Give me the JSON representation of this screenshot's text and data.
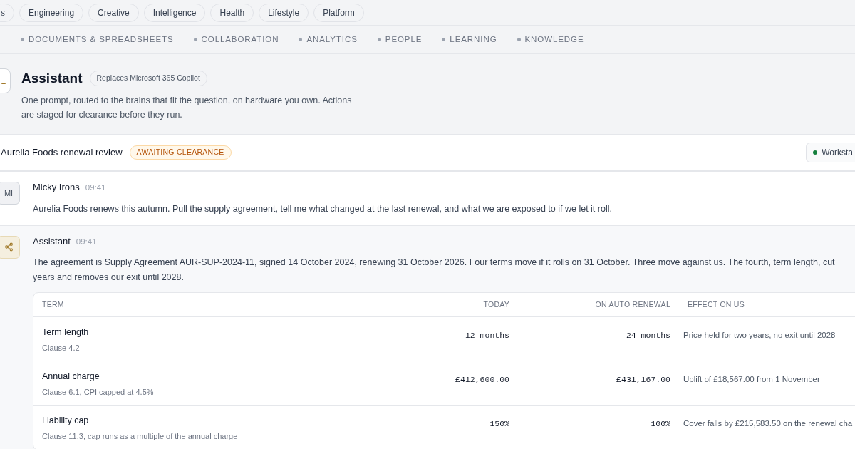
{
  "category_pills": [
    {
      "label": "s",
      "selected": false
    },
    {
      "label": "Engineering",
      "selected": false
    },
    {
      "label": "Creative",
      "selected": false
    },
    {
      "label": "Intelligence",
      "selected": false
    },
    {
      "label": "Health",
      "selected": false
    },
    {
      "label": "Lifestyle",
      "selected": false
    },
    {
      "label": "Platform",
      "selected": false
    }
  ],
  "section_nav": [
    {
      "label": "DOCUMENTS & SPREADSHEETS"
    },
    {
      "label": "COLLABORATION"
    },
    {
      "label": "ANALYTICS"
    },
    {
      "label": "PEOPLE"
    },
    {
      "label": "LEARNING"
    },
    {
      "label": "KNOWLEDGE"
    }
  ],
  "app_header": {
    "title": "Assistant",
    "badge": "Replaces Microsoft 365 Copilot",
    "description_lines": [
      "One prompt, routed to the brains that fit the question, on hardware you own. Actions",
      "are staged for clearance before they run."
    ]
  },
  "thread": {
    "title": "Aurelia Foods renewal review",
    "status": "AWAITING CLEARANCE",
    "host": {
      "label": "Worksta",
      "color": "#15803d"
    }
  },
  "messages": [
    {
      "kind": "user",
      "avatar": "MI",
      "author": "Micky Irons",
      "time": "09:41",
      "lines": [
        "Aurelia Foods renews this autumn. Pull the supply agreement, tell me what changed at the last renewal, and what we are exposed to if we let it roll."
      ]
    },
    {
      "kind": "assistant",
      "author": "Assistant",
      "time": "09:41",
      "lines": [
        "The agreement is Supply Agreement AUR-SUP-2024-11, signed 14 October 2024, renewing 31 October 2026. Four terms move if it rolls on 31 October. Three move against us. The fourth, term length, cut",
        "years and removes our exit until 2028."
      ],
      "table": {
        "columns": [
          "TERM",
          "TODAY",
          "ON AUTO RENEWAL",
          "EFFECT ON US"
        ],
        "rows": [
          {
            "term": "Term length",
            "clause": "Clause 4.2",
            "today": "12 months",
            "renewal": "24 months",
            "effect": "Price held for two years, no exit until 2028"
          },
          {
            "term": "Annual charge",
            "clause": "Clause 6.1, CPI capped at 4.5%",
            "today": "£412,600.00",
            "renewal": "£431,167.00",
            "effect": "Uplift of £18,567.00 from 1 November"
          },
          {
            "term": "Liability cap",
            "clause": "Clause 11.3, cap runs as a multiple of the annual charge",
            "today": "150%",
            "renewal": "100%",
            "effect": "Cover falls by £215,583.50 on the renewal cha"
          }
        ]
      }
    }
  ]
}
